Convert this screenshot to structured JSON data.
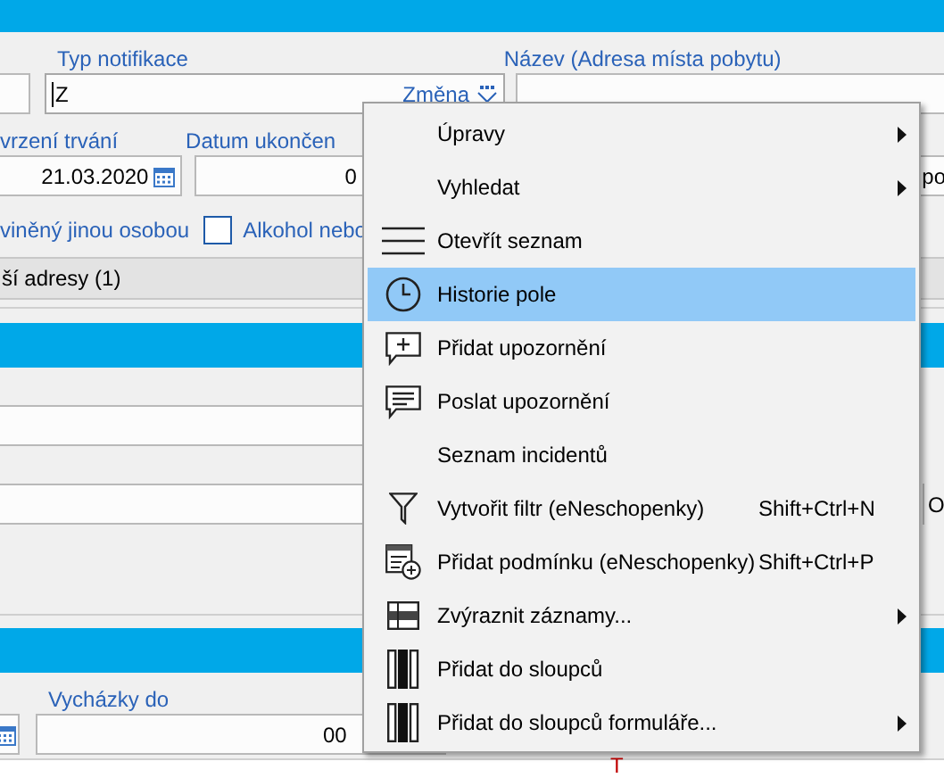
{
  "form": {
    "notification_type": {
      "label": "Typ notifikace",
      "value": "Z",
      "action": "Změna"
    },
    "name_field": {
      "label": "Název (Adresa místa pobytu)"
    },
    "duration_field": {
      "label": "vrzení trvání",
      "value": "21.03.2020"
    },
    "end_date_field": {
      "label": "Datum ukončen",
      "value": "0"
    },
    "side_field": {
      "value": "po"
    },
    "caused_label": "viněný jinou osobou",
    "alcohol_checkbox": {
      "label": "Alkohol nebo",
      "checked": false
    },
    "section": {
      "title": "ší adresy (1)"
    },
    "side_cell": {
      "value": "O"
    },
    "outings_field": {
      "label": "Vycházky do",
      "value": "00"
    },
    "bottom_cell": {
      "value": "T"
    }
  },
  "context_menu": {
    "items": [
      {
        "label": "Úpravy",
        "submenu": true,
        "selected": false
      },
      {
        "label": "Vyhledat",
        "submenu": true,
        "selected": false
      },
      {
        "label": "Otevřít seznam",
        "submenu": false,
        "selected": false
      },
      {
        "label": "Historie pole",
        "submenu": false,
        "selected": true
      },
      {
        "label": "Přidat upozornění",
        "submenu": false,
        "selected": false
      },
      {
        "label": "Poslat upozornění",
        "submenu": false,
        "selected": false
      },
      {
        "label": "Seznam incidentů",
        "submenu": false,
        "selected": false
      },
      {
        "label": "Vytvořit filtr (eNeschopenky)",
        "shortcut": "Shift+Ctrl+N",
        "submenu": false,
        "selected": false
      },
      {
        "label": "Přidat podmínku (eNeschopenky)",
        "shortcut": "Shift+Ctrl+P",
        "submenu": false,
        "selected": false
      },
      {
        "label": "Zvýraznit záznamy...",
        "submenu": true,
        "selected": false
      },
      {
        "label": "Přidat do sloupců",
        "submenu": false,
        "selected": false
      },
      {
        "label": "Přidat do sloupců formuláře...",
        "submenu": true,
        "selected": false
      }
    ]
  }
}
